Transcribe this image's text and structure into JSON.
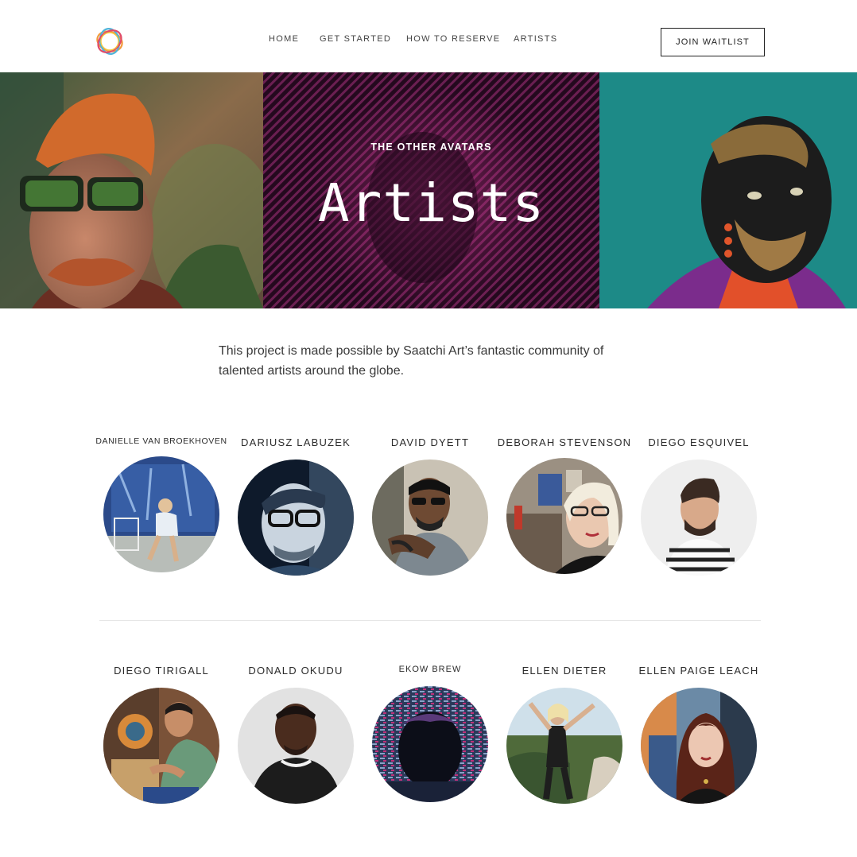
{
  "header": {
    "nav": [
      {
        "label": "HOME"
      },
      {
        "label": "GET STARTED"
      },
      {
        "label": "HOW TO RESERVE"
      },
      {
        "label": "ARTISTS"
      }
    ],
    "join_label": "JOIN WAITLIST"
  },
  "hero": {
    "eyebrow": "THE OTHER AVATARS",
    "title": "Artists"
  },
  "intro": {
    "text": "This project is made possible by Saatchi Art’s fantastic community of talented artists around the globe."
  },
  "artists_row1": [
    {
      "name": "DANIELLE VAN BROEKHOVEN"
    },
    {
      "name": "DARIUSZ LABUZEK"
    },
    {
      "name": "DAVID DYETT"
    },
    {
      "name": "DEBORAH STEVENSON"
    },
    {
      "name": "DIEGO ESQUIVEL"
    }
  ],
  "artists_row2": [
    {
      "name": "DIEGO TIRIGALL"
    },
    {
      "name": "DONALD OKUDU"
    },
    {
      "name": "EKOW BREW"
    },
    {
      "name": "ELLEN DIETER"
    },
    {
      "name": "ELLEN PAIGE LEACH"
    }
  ],
  "colors": {
    "hero_mid": "#2a0e24",
    "hero_right": "#1d8a87",
    "accent_magenta": "#b0307e"
  }
}
